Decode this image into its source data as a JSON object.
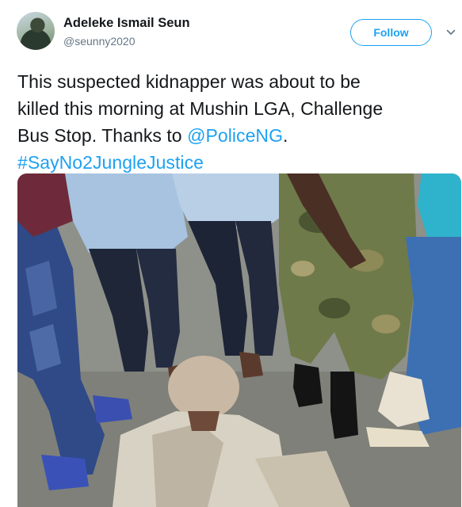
{
  "author": {
    "display_name": "Adeleke Ismail Seun",
    "handle": "@seunny2020"
  },
  "actions": {
    "follow_label": "Follow",
    "menu_icon": "chevron-down-icon"
  },
  "tweet": {
    "line1": "This suspected kidnapper was about to be",
    "line2": "killed this morning at Mushin LGA, Challenge",
    "line3_prefix": "Bus Stop. Thanks to ",
    "mention": "@PoliceNG",
    "line3_suffix": ".",
    "hashtag": "#SayNo2JungleJustice"
  },
  "colors": {
    "accent": "#1da1f2",
    "text": "#14171a",
    "secondary": "#657786"
  }
}
